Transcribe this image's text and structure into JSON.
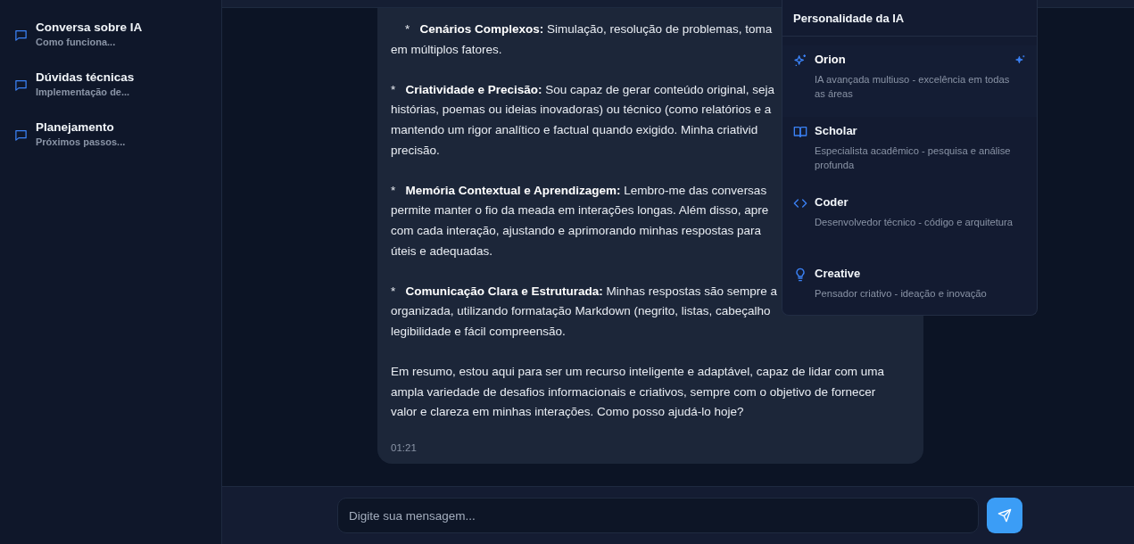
{
  "sidebar": {
    "conversations": [
      {
        "title": "Conversa sobre IA",
        "preview": "Como funciona..."
      },
      {
        "title": "Dúvidas técnicas",
        "preview": "Implementação de..."
      },
      {
        "title": "Planejamento",
        "preview": "Próximos passos..."
      }
    ]
  },
  "message": {
    "paragraphs": [
      {
        "lines": [
          {
            "kind": "indented",
            "text": "*   **Cenários Complexos:** Simulação, resolução de problemas, toma"
          },
          {
            "kind": "plain",
            "text": "em múltiplos fatores."
          }
        ]
      },
      {
        "lines": [
          {
            "kind": "plain",
            "text": "*   **Criatividade e Precisão:** Sou capaz de gerar conteúdo original, seja"
          },
          {
            "kind": "plain",
            "text": "histórias, poemas ou ideias inovadoras) ou técnico (como relatórios e a"
          },
          {
            "kind": "plain",
            "text": "mantendo um rigor analítico e factual quando exigido. Minha criativid"
          },
          {
            "kind": "plain",
            "text": "precisão."
          }
        ]
      },
      {
        "lines": [
          {
            "kind": "plain",
            "text": "*   **Memória Contextual e Aprendizagem:** Lembro-me das conversas"
          },
          {
            "kind": "plain",
            "text": "permite manter o fio da meada em interações longas. Além disso, apre"
          },
          {
            "kind": "plain",
            "text": "com cada interação, ajustando e aprimorando minhas respostas para"
          },
          {
            "kind": "plain",
            "text": "úteis e adequadas."
          }
        ]
      },
      {
        "lines": [
          {
            "kind": "plain",
            "text": "*   **Comunicação Clara e Estruturada:** Minhas respostas são sempre a"
          },
          {
            "kind": "plain",
            "text": "organizada, utilizando formatação Markdown (negrito, listas, cabeçalho"
          },
          {
            "kind": "plain",
            "text": "legibilidade e fácil compreensão."
          }
        ]
      },
      {
        "lines": [
          {
            "kind": "plain",
            "text": "Em resumo, estou aqui para ser um recurso inteligente e adaptável, capaz de lidar com uma"
          },
          {
            "kind": "plain",
            "text": "ampla variedade de desafios informacionais e criativos, sempre com o objetivo de fornecer"
          },
          {
            "kind": "plain",
            "text": "valor e clareza em minhas interações. Como posso ajudá-lo hoje?"
          }
        ]
      }
    ],
    "time": "01:21"
  },
  "personality_menu": {
    "title": "Personalidade da IA",
    "items": [
      {
        "kind": "sparkles",
        "name": "Orion",
        "description": "IA avançada multiuso - excelência em todas as áreas",
        "selected": true
      },
      {
        "kind": "book",
        "name": "Scholar",
        "description": "Especialista acadêmico - pesquisa e análise profunda",
        "selected": false
      },
      {
        "kind": "code",
        "name": "Coder",
        "description": "Desenvolvedor técnico - código e arquitetura",
        "selected": false
      },
      {
        "kind": "bulb",
        "name": "Creative",
        "description": "Pensador criativo - ideação e inovação",
        "selected": false
      }
    ]
  },
  "composer": {
    "placeholder": "Digite sua mensagem..."
  }
}
